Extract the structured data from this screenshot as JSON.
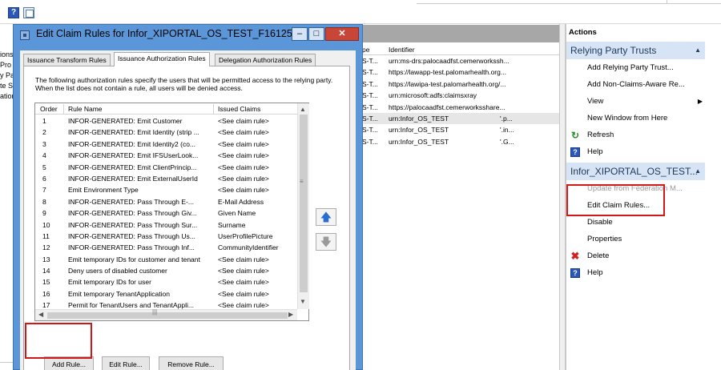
{
  "left_tree": [
    "ions",
    "Pro",
    "y Pa",
    "te St",
    "ation"
  ],
  "center": {
    "columns": {
      "type": "pe",
      "identifier": "Identifier"
    },
    "rows": [
      {
        "type": "S-T...",
        "identifier": "urn:ms-drs:palocaadfst.cemerworkssh...",
        "extra": ""
      },
      {
        "type": "S-T...",
        "identifier": "https://lawapp-test.palomarhealth.org...",
        "extra": ""
      },
      {
        "type": "S-T...",
        "identifier": "https://lawipa-test.palomarhealth.org/...",
        "extra": ""
      },
      {
        "type": "S-T...",
        "identifier": "urn:microsoft:adfs:claimsxray",
        "extra": ""
      },
      {
        "type": "S-T...",
        "identifier": "https://palocaadfst.cemerworksshare...",
        "extra": ""
      },
      {
        "type": "S-T...",
        "identifier": "urn:Infor_OS_TEST",
        "extra": "'.p..."
      },
      {
        "type": "S-T...",
        "identifier": "urn:Infor_OS_TEST",
        "extra": "'.in..."
      },
      {
        "type": "S-T...",
        "identifier": "urn:Infor_OS_TEST",
        "extra": "'.G..."
      }
    ]
  },
  "actions": {
    "title": "Actions",
    "sections": [
      {
        "title": "Relying Party Trusts",
        "items": [
          {
            "label": "Add Relying Party Trust...",
            "icon": "",
            "disabled": false
          },
          {
            "label": "Add Non-Claims-Aware Re...",
            "icon": "",
            "disabled": false
          },
          {
            "label": "View",
            "icon": "",
            "disabled": false,
            "submenu": true
          },
          {
            "label": "New Window from Here",
            "icon": "",
            "disabled": false
          },
          {
            "label": "Refresh",
            "icon": "refresh-icon",
            "disabled": false
          },
          {
            "label": "Help",
            "icon": "help-icon",
            "disabled": false
          }
        ]
      },
      {
        "title": "Infor_XIPORTAL_OS_TEST...",
        "items": [
          {
            "label": "Update from Federation M...",
            "icon": "",
            "disabled": true
          },
          {
            "label": "Edit Claim Rules...",
            "icon": "",
            "disabled": false
          },
          {
            "label": "Disable",
            "icon": "",
            "disabled": false
          },
          {
            "label": "Properties",
            "icon": "",
            "disabled": false
          },
          {
            "label": "Delete",
            "icon": "delete-icon",
            "disabled": false
          },
          {
            "label": "Help",
            "icon": "help-icon",
            "disabled": false
          }
        ]
      }
    ]
  },
  "dialog": {
    "title": "Edit Claim Rules for Infor_XIPORTAL_OS_TEST_F161256...",
    "tabs": [
      "Issuance Transform Rules",
      "Issuance Authorization Rules",
      "Delegation Authorization Rules"
    ],
    "active_tab": 1,
    "description": "The following authorization rules specify the users that will be permitted access to the relying party. When the list does not contain a rule, all users will be denied access.",
    "columns": {
      "order": "Order",
      "name": "Rule Name",
      "claims": "Issued Claims"
    },
    "rules": [
      {
        "order": "1",
        "name": "INFOR-GENERATED: Emit Customer",
        "claims": "<See claim rule>"
      },
      {
        "order": "2",
        "name": "INFOR-GENERATED: Emit Identity (strip ...",
        "claims": "<See claim rule>"
      },
      {
        "order": "3",
        "name": "INFOR-GENERATED: Emit Identity2 (co...",
        "claims": "<See claim rule>"
      },
      {
        "order": "4",
        "name": "INFOR-GENERATED: Emit IFSUserLook...",
        "claims": "<See claim rule>"
      },
      {
        "order": "5",
        "name": "INFOR-GENERATED: Emit ClientPrincip...",
        "claims": "<See claim rule>"
      },
      {
        "order": "6",
        "name": "INFOR-GENERATED: Emit ExternalUserId",
        "claims": "<See claim rule>"
      },
      {
        "order": "7",
        "name": "Emit Environment Type",
        "claims": "<See claim rule>"
      },
      {
        "order": "8",
        "name": "INFOR-GENERATED: Pass Through E-...",
        "claims": "E-Mail Address"
      },
      {
        "order": "9",
        "name": "INFOR-GENERATED: Pass Through Giv...",
        "claims": "Given Name"
      },
      {
        "order": "10",
        "name": "INFOR-GENERATED: Pass Through Sur...",
        "claims": "Surname"
      },
      {
        "order": "11",
        "name": "INFOR-GENERATED: Pass Through Us...",
        "claims": "UserProfilePicture"
      },
      {
        "order": "12",
        "name": "INFOR-GENERATED: Pass Through Inf...",
        "claims": "CommunityIdentifier"
      },
      {
        "order": "13",
        "name": "Emit temporary IDs for customer and tenant",
        "claims": "<See claim rule>"
      },
      {
        "order": "14",
        "name": "Deny users of disabled customer",
        "claims": "<See claim rule>"
      },
      {
        "order": "15",
        "name": "Emit temporary IDs for user",
        "claims": "<See claim rule>"
      },
      {
        "order": "16",
        "name": "Emit temporary TenantApplication",
        "claims": "<See claim rule>"
      },
      {
        "order": "17",
        "name": "Permit for TenantUsers and TenantAppli...",
        "claims": "<See claim rule>"
      }
    ],
    "buttons": {
      "add": "Add Rule...",
      "edit": "Edit Rule...",
      "remove": "Remove Rule..."
    }
  },
  "colors": {
    "highlight": "#d01818",
    "dialog_frame": "#5a96d8",
    "section_header": "#d6e4f5"
  }
}
